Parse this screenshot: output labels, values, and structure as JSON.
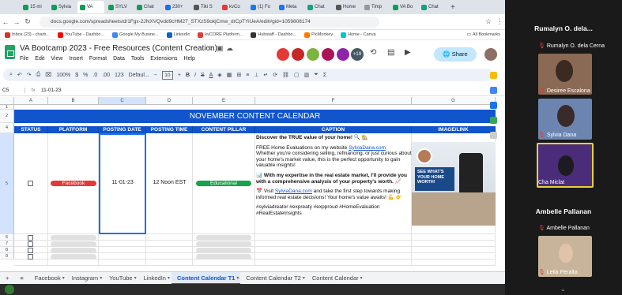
{
  "browser": {
    "tabs": [
      {
        "label": "15 mi",
        "color": "#0f9d58"
      },
      {
        "label": "Sylvia",
        "color": "#0f9d58"
      },
      {
        "label": "VA",
        "color": "#0f9d58"
      },
      {
        "label": "SYLV",
        "color": "#0f9d58"
      },
      {
        "label": "Chat",
        "color": "#0f9d58"
      },
      {
        "label": "230+",
        "color": "#1a73e8"
      },
      {
        "label": "Tiki S",
        "color": "#555555"
      },
      {
        "label": "kvCo",
        "color": "#e53935"
      },
      {
        "label": "(1) Fo",
        "color": "#1877f2"
      },
      {
        "label": "Meta",
        "color": "#1877f2"
      },
      {
        "label": "Chat",
        "color": "#10a37f"
      },
      {
        "label": "Home",
        "color": "#555555"
      },
      {
        "label": "Timp",
        "color": "#999999"
      },
      {
        "label": "VA Bo",
        "color": "#0f9d58"
      },
      {
        "label": "Chat",
        "color": "#10a37f"
      }
    ],
    "active_tab_index": 2,
    "url": "docs.google.com/spreadsheets/d/1Fgx-2JNXVQvdd9cHM27_STXzS9okjCmw_drCpTYiUeA/edit#gid=1059808174",
    "bookmarks": [
      "Inbox (23) - charb...",
      "YouTube - Dashbo...",
      "Google My Busine...",
      "LinkedIn",
      "kvCORE Platform...",
      "Hubstaff - Dashbo...",
      "PicMonkey",
      "Home - Canva"
    ],
    "all_bookmarks": "All Bookmarks"
  },
  "doc": {
    "title": "VA Bootcamp 2023 - Free Resources (Content Creation)",
    "menu": [
      "File",
      "Edit",
      "View",
      "Insert",
      "Format",
      "Data",
      "Tools",
      "Extensions",
      "Help"
    ],
    "share_label": "Share",
    "collab_count": "+19"
  },
  "toolbar": {
    "zoom": "100%",
    "currency": "$",
    "percent": "%",
    "dec1": ".0",
    "dec2": ".00",
    "num": "123",
    "font": "Defaul...",
    "size": "10"
  },
  "formula": {
    "cell": "C5",
    "fx": "fx",
    "value": "11-01-23"
  },
  "grid": {
    "columns": [
      "A",
      "B",
      "C",
      "D",
      "E",
      "F",
      "G"
    ],
    "rows": [
      "1",
      "2",
      "4",
      "5",
      "6",
      "7",
      "8",
      "9"
    ],
    "banner": "NOVEMBER CONTENT CALENDAR",
    "headers": [
      "STATUS",
      "PLATFORM",
      "POSTING DATE",
      "POSTING TIME",
      "CONTENT PILLAR",
      "CAPTION",
      "IMAGE/LINK"
    ],
    "row5": {
      "platform": "Facebook",
      "platform_color": "#e53935",
      "date": "11-01-23",
      "time": "12 Noon EST",
      "pillar": "Educational",
      "pillar_color": "#16a34a"
    },
    "caption": {
      "p1": "Discover the TRUE value of your home! 🔍 🏡",
      "p2a": "FREE Home Evaluations on my website ",
      "p2link": "SylviaDana.com",
      "p2b": "Whether you're considering selling, refinancing, or just curious about your home's market value, this is the perfect opportunity to gain valuable insights!",
      "p3": "📊 With my expertise in the real estate market, I'll provide you with a comprehensive analysis of your property's worth. 📈",
      "p4a": "📅 Visit ",
      "p4link": "SylviaDana.com",
      "p4b": " and take the first step towards making informed real estate decisions! Your home's value awaits! 💪 👉",
      "p5": "#sylviadreator #expreaty #expproud #HomeEvaluation #RealEstateInsights"
    },
    "image_text": "SEE WHAT'S YOUR HOME WORTH!"
  },
  "sheet_tabs": [
    "Facebook",
    "Instagram",
    "YouTube",
    "LinkedIn",
    "Content Calendar T1",
    "Content Calendar T2",
    "Content Calendar"
  ],
  "active_sheet": "Content Calendar T1",
  "zoom": {
    "top_name": "Rumalyn O. dela...",
    "p1": "Rumalyn O. dela Cerna",
    "p2": "Desiree Escalona",
    "p3": "Sylvia Dana",
    "p4": "Cha Miclat",
    "mid_name": "Ambelle Pallanan",
    "p5": "Ambelle Pallanan",
    "p6": "Leila Peralta"
  }
}
